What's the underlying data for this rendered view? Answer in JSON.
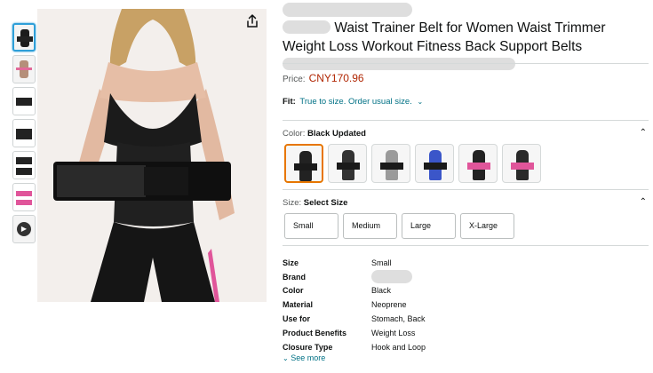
{
  "thumbnails": [
    {
      "kind": "photo",
      "selected": true
    },
    {
      "kind": "chart",
      "selected": false
    },
    {
      "kind": "detail",
      "selected": false
    },
    {
      "kind": "belt",
      "selected": false
    },
    {
      "kind": "size-chart",
      "selected": false
    },
    {
      "kind": "pink",
      "selected": false
    },
    {
      "kind": "video",
      "selected": false
    }
  ],
  "product": {
    "title": "Waist Trainer Belt for Women Waist Trimmer Weight Loss Workout Fitness Back Support Belts",
    "price_label": "Price:",
    "price_value": "CNY170.96",
    "fit_label": "Fit:",
    "fit_text": "True to size. Order usual size."
  },
  "color_section": {
    "label": "Color:",
    "selected": "Black Updated",
    "swatches": [
      "black-tank",
      "black-strap",
      "black-belt-white",
      "blue-black",
      "pink-black",
      "pink-black-2"
    ]
  },
  "size_section": {
    "label": "Size:",
    "selected": "Select Size",
    "options": [
      "Small",
      "Medium",
      "Large",
      "X-Large"
    ]
  },
  "specs": [
    {
      "key": "Size",
      "value": "Small"
    },
    {
      "key": "Brand",
      "value": ""
    },
    {
      "key": "Color",
      "value": "Black"
    },
    {
      "key": "Material",
      "value": "Neoprene"
    },
    {
      "key": "Use for",
      "value": "Stomach, Back"
    },
    {
      "key": "Product Benefits",
      "value": "Weight Loss"
    },
    {
      "key": "Closure Type",
      "value": "Hook and Loop"
    }
  ],
  "see_more": "See more",
  "colors": {
    "price": "#b12704",
    "link": "#007185",
    "selected_swatch": "#e77600",
    "selected_thumb": "#2f9fd8"
  },
  "icons": {
    "share": "share-icon",
    "caret": "chevron-up-icon",
    "see_more": "chevron-down-icon"
  }
}
